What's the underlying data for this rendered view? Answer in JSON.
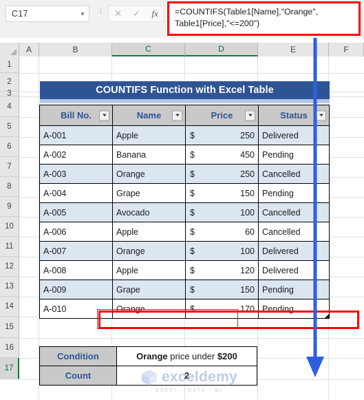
{
  "app": {
    "name_box_value": "C17",
    "formula": "=COUNTIFS(Table1[Name],\"Orange\", Table1[Price],\"<=200\")",
    "cancel_icon": "✕",
    "confirm_icon": "✓",
    "fx_icon": "fx",
    "name_box_caret": "▼",
    "dots": "⋮"
  },
  "columns": [
    "A",
    "B",
    "C",
    "D",
    "E",
    "F"
  ],
  "rows": [
    "1",
    "2",
    "3",
    "4",
    "5",
    "6",
    "7",
    "8",
    "9",
    "10",
    "11",
    "12",
    "13",
    "14",
    "15",
    "16",
    "17"
  ],
  "selected": {
    "columns": [
      "C",
      "D"
    ],
    "row": "17",
    "cell": "C17"
  },
  "banner": {
    "title": "COUNTIFS Function with Excel Table"
  },
  "table": {
    "headers": [
      "Bill No.",
      "Name",
      "Price",
      "Status"
    ],
    "currency_symbol": "$",
    "rows": [
      {
        "bill": "A-001",
        "name": "Apple",
        "price": "250",
        "status": "Delivered"
      },
      {
        "bill": "A-002",
        "name": "Banana",
        "price": "450",
        "status": "Pending"
      },
      {
        "bill": "A-003",
        "name": "Orange",
        "price": "250",
        "status": "Cancelled"
      },
      {
        "bill": "A-004",
        "name": "Grape",
        "price": "150",
        "status": "Pending"
      },
      {
        "bill": "A-005",
        "name": "Avocado",
        "price": "100",
        "status": "Cancelled"
      },
      {
        "bill": "A-006",
        "name": "Apple",
        "price": "60",
        "status": "Cancelled"
      },
      {
        "bill": "A-007",
        "name": "Orange",
        "price": "100",
        "status": "Delivered"
      },
      {
        "bill": "A-008",
        "name": "Apple",
        "price": "120",
        "status": "Delivered"
      },
      {
        "bill": "A-009",
        "name": "Grape",
        "price": "150",
        "status": "Pending"
      },
      {
        "bill": "A-010",
        "name": "Orange",
        "price": "170",
        "status": "Pending"
      }
    ]
  },
  "summary": {
    "condition_label": "Condition",
    "condition_value_bold_1": "Orange",
    "condition_value_mid": " price under ",
    "condition_value_bold_2": "$200",
    "count_label": "Count",
    "count_value": "2"
  },
  "watermark": {
    "text": "exceldemy",
    "subtitle": "EXCEL · DATA · BI"
  },
  "colors": {
    "banner_blue": "#2f5496",
    "banner_underline": "#b4c7e7",
    "header_gray": "#c9c9c9",
    "band_blue": "#dce6f1",
    "annotation_red": "#ff0000",
    "annotation_arrow_blue": "#2f5fe0",
    "selection_green": "#1a7544"
  }
}
